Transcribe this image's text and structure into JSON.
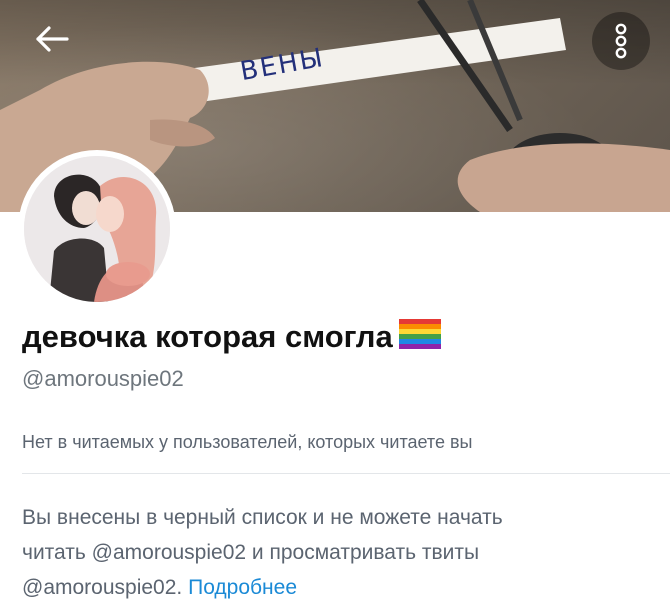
{
  "header": {
    "banner_caption": "ВЕНЫ",
    "back_icon": "arrow-left-icon",
    "more_icon": "more-options-icon"
  },
  "profile": {
    "display_name": "девочка которая смогла",
    "name_emoji": "rainbow-flag-icon",
    "handle": "@amorouspie02",
    "follow_note": "Нет в читаемых у пользователей, которых читаете вы"
  },
  "blocked_notice": {
    "line1": "Вы внесены в черный список и не можете начать",
    "line2": "читать @amorouspie02 и просматривать твиты",
    "line3_prefix": "@amorouspie02.",
    "learn_more": "Подробнее"
  },
  "colors": {
    "link": "#1b8ad6",
    "secondary_text": "#5b6470",
    "primary_text": "#111111"
  }
}
